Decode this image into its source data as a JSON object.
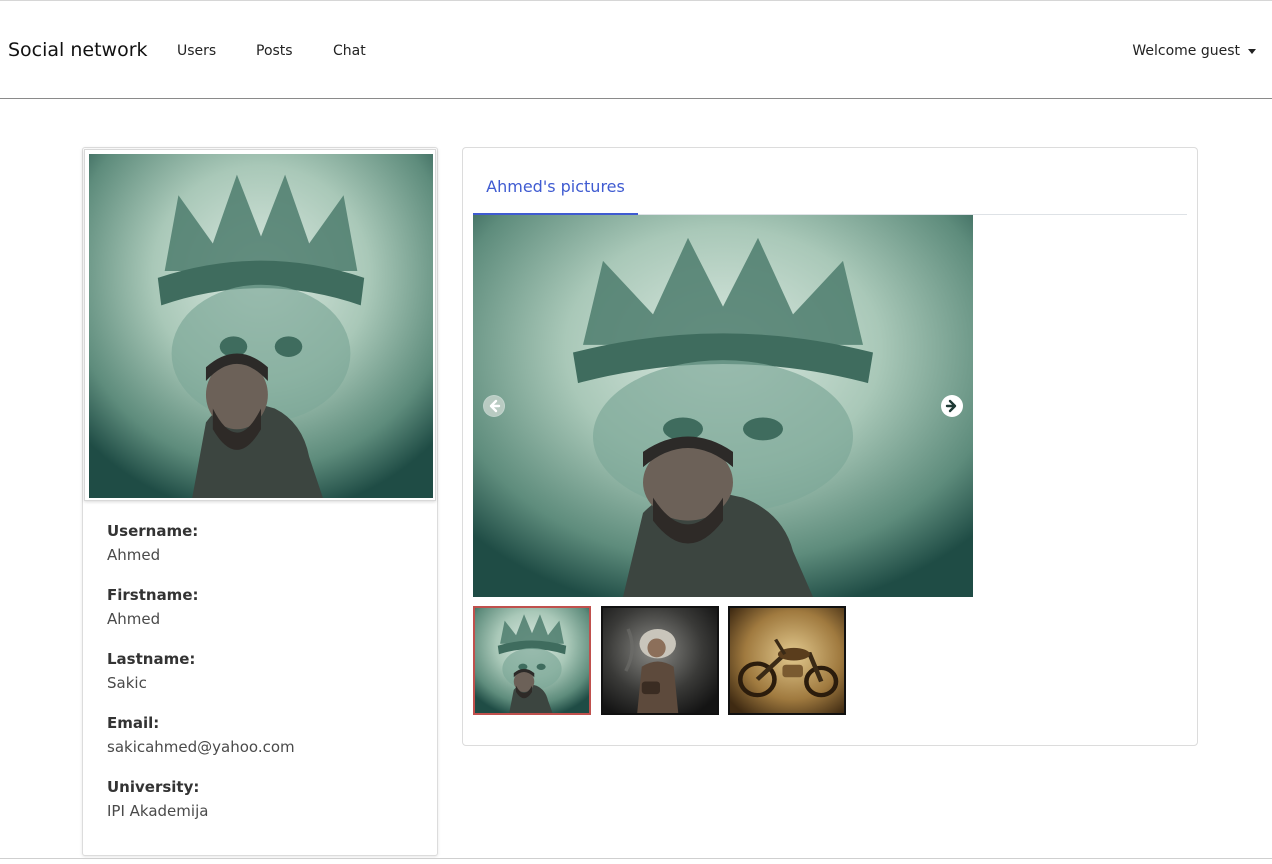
{
  "navbar": {
    "brand": "Social network",
    "links": [
      "Users",
      "Posts",
      "Chat"
    ],
    "welcome": "Welcome guest",
    "dropdown_icon": "caret-down-icon"
  },
  "profile": {
    "avatar_image": "profile-photo",
    "fields": [
      {
        "label": "Username:",
        "value": "Ahmed"
      },
      {
        "label": "Firstname:",
        "value": "Ahmed"
      },
      {
        "label": "Lastname:",
        "value": "Sakic"
      },
      {
        "label": "Email:",
        "value": "sakicahmed@yahoo.com"
      },
      {
        "label": "University:",
        "value": "IPI Akademija"
      }
    ]
  },
  "pictures": {
    "tab_label": "Ahmed's pictures",
    "active_thumbnail": 1,
    "thumbnails": [
      "crown-portrait-thumbnail",
      "fighter-portrait-thumbnail",
      "motorcycle-thumbnail"
    ],
    "prev_icon": "arrow-left-circle-icon",
    "next_icon": "arrow-right-circle-icon",
    "accent_color": "#3f5bd1",
    "active_border_color": "#c0504d"
  }
}
